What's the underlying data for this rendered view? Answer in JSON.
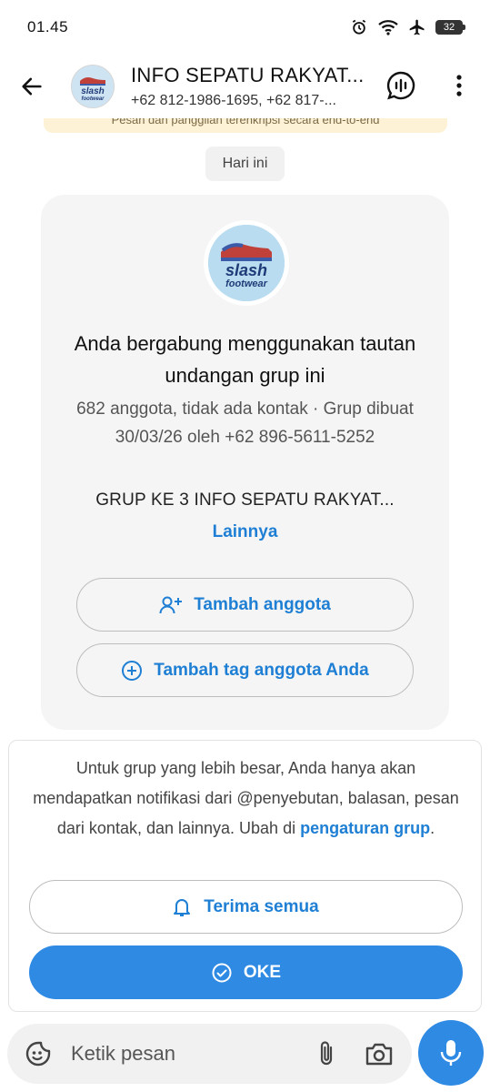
{
  "status_bar": {
    "time": "01.45",
    "battery": "32",
    "icons": [
      "alarm-icon",
      "wifi-icon",
      "airplane-icon",
      "battery-icon"
    ]
  },
  "header": {
    "title": "INFO SEPATU RAKYAT...",
    "subtitle": "+62 812-1986-1695, +62 817-...",
    "avatar_text_line1": "slash",
    "avatar_text_line2": "footwear"
  },
  "chat": {
    "encryption_notice": "Pesan dan panggilan terenkripsi secara end-to-end",
    "date_chip": "Hari ini",
    "group_card": {
      "avatar_text_line1": "slash",
      "avatar_text_line2": "footwear",
      "title": "Anda bergabung menggunakan tautan undangan grup ini",
      "meta": "682 anggota, tidak ada kontak · Grup dibuat 30/03/26 oleh +62 896-5611-5252",
      "description": "GRUP KE 3 INFO SEPATU RAKYAT...",
      "more_link": "Lainnya",
      "add_member_button": "Tambah anggota",
      "add_tag_button": "Tambah tag anggota Anda"
    },
    "notification_panel": {
      "text": "Untuk grup yang lebih besar, Anda hanya akan mendapatkan notifikasi dari @penyebutan, balasan, pesan dari kontak, dan lainnya. Ubah di ",
      "link": "pengaturan grup",
      "text_end": ".",
      "accept_all_button": "Terima semua",
      "ok_button": "OKE"
    }
  },
  "input_bar": {
    "placeholder": "Ketik pesan"
  },
  "colors": {
    "accent": "#2f8ae4",
    "link": "#1e7fd4",
    "card_bg": "#f5f5f5",
    "banner_bg": "#fdf1d6"
  }
}
